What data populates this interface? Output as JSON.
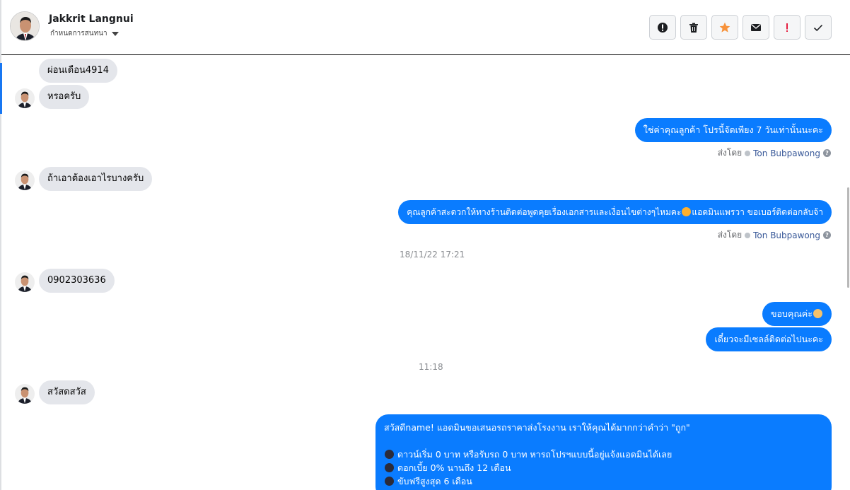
{
  "header": {
    "name": "Jakkrit Langnui",
    "subtitle": "กำหนดการสนทนา",
    "actions": [
      {
        "icon": "alert-circle-icon"
      },
      {
        "icon": "trash-icon"
      },
      {
        "icon": "star-icon"
      },
      {
        "icon": "envelope-icon"
      },
      {
        "icon": "exclamation-icon"
      },
      {
        "icon": "check-icon"
      }
    ],
    "colors": {
      "star": "#f7923b",
      "exclamation": "#e41e3f"
    }
  },
  "messages": {
    "in1": "ผ่อนเดือน4914",
    "in2": "หรอครับ",
    "out1": "ใช่ค่าคุณลูกค้า โปรนี้จัดเพียง 7 วันเท่านั้นนะคะ",
    "sent1": {
      "prefix": "ส่งโดย",
      "agent": "Ton Bubpawong"
    },
    "in3": "ถ้าเอาต้องเอาไรบางครับ",
    "out2_a": "คุณลูกค้าสะดวกให้ทางร้านติดต่อพูดคุยเรื่องเอกสารและเงื่อนไขต่างๆไหมคะ",
    "out2_b": "แอดมินแพรวา ขอเบอร์ติดต่อกลับจ้า",
    "sent2": {
      "prefix": "ส่งโดย",
      "agent": "Ton Bubpawong"
    },
    "ts1": "18/11/22 17:21",
    "in4": "0902303636",
    "out3": "ขอบคุณค่ะ",
    "out4": "เดี๋ยวจะมีเซลล์ติดต่อไปนะคะ",
    "ts2": "11:18",
    "in5": "สวัสดสวัส",
    "big": {
      "l1": "สวัสดีname! แอดมินขอเสนอรถราคาส่งโรงงาน เราให้คุณได้มากกว่าคำว่า \"ถูก\"",
      "l2": "ดาวน์เริ่ม 0 บาท หรือรับรถ 0 บาท หารถโปรฯแบบนี้อยู่แจ้งแอดมินได้เลย",
      "l3": "ดอกเบี้ย 0% นานถึง 12 เดือน",
      "l4": "ขับฟรีสูงสุด 6 เดือน"
    }
  },
  "colors": {
    "outgoing": "#0a7cff",
    "incoming": "#e4e6eb",
    "accent": "#1877f2"
  }
}
